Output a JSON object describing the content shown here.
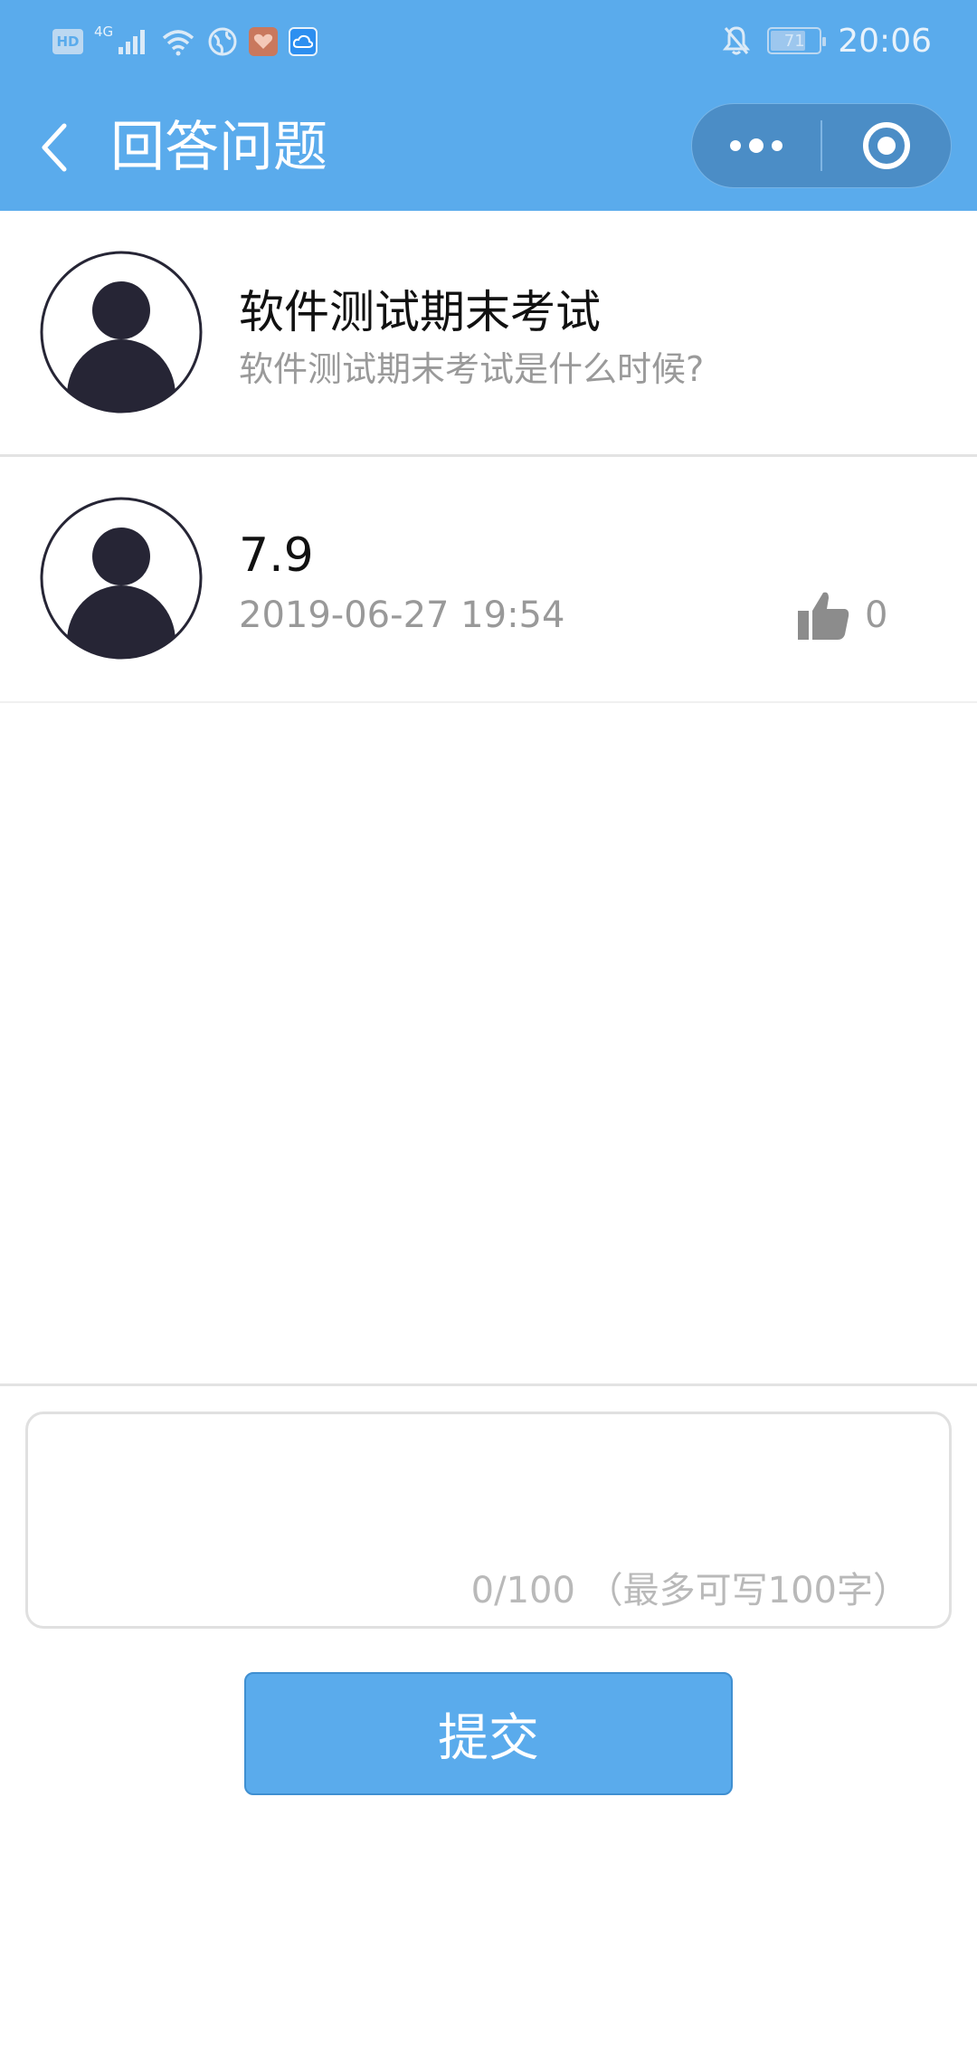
{
  "status_bar": {
    "hd": "HD",
    "network": "4G",
    "battery": "71",
    "time": "20:06"
  },
  "nav": {
    "title": "回答问题"
  },
  "question": {
    "title": "软件测试期末考试",
    "subtitle": "软件测试期末考试是什么时候?"
  },
  "answers": [
    {
      "text": "7.9",
      "time": "2019-06-27 19:54",
      "likes": "0"
    }
  ],
  "composer": {
    "value": "",
    "counter": "0/100 （最多可写100字）",
    "submit_label": "提交"
  },
  "colors": {
    "primary": "#5aabec",
    "capsule": "#4b8dc6"
  }
}
